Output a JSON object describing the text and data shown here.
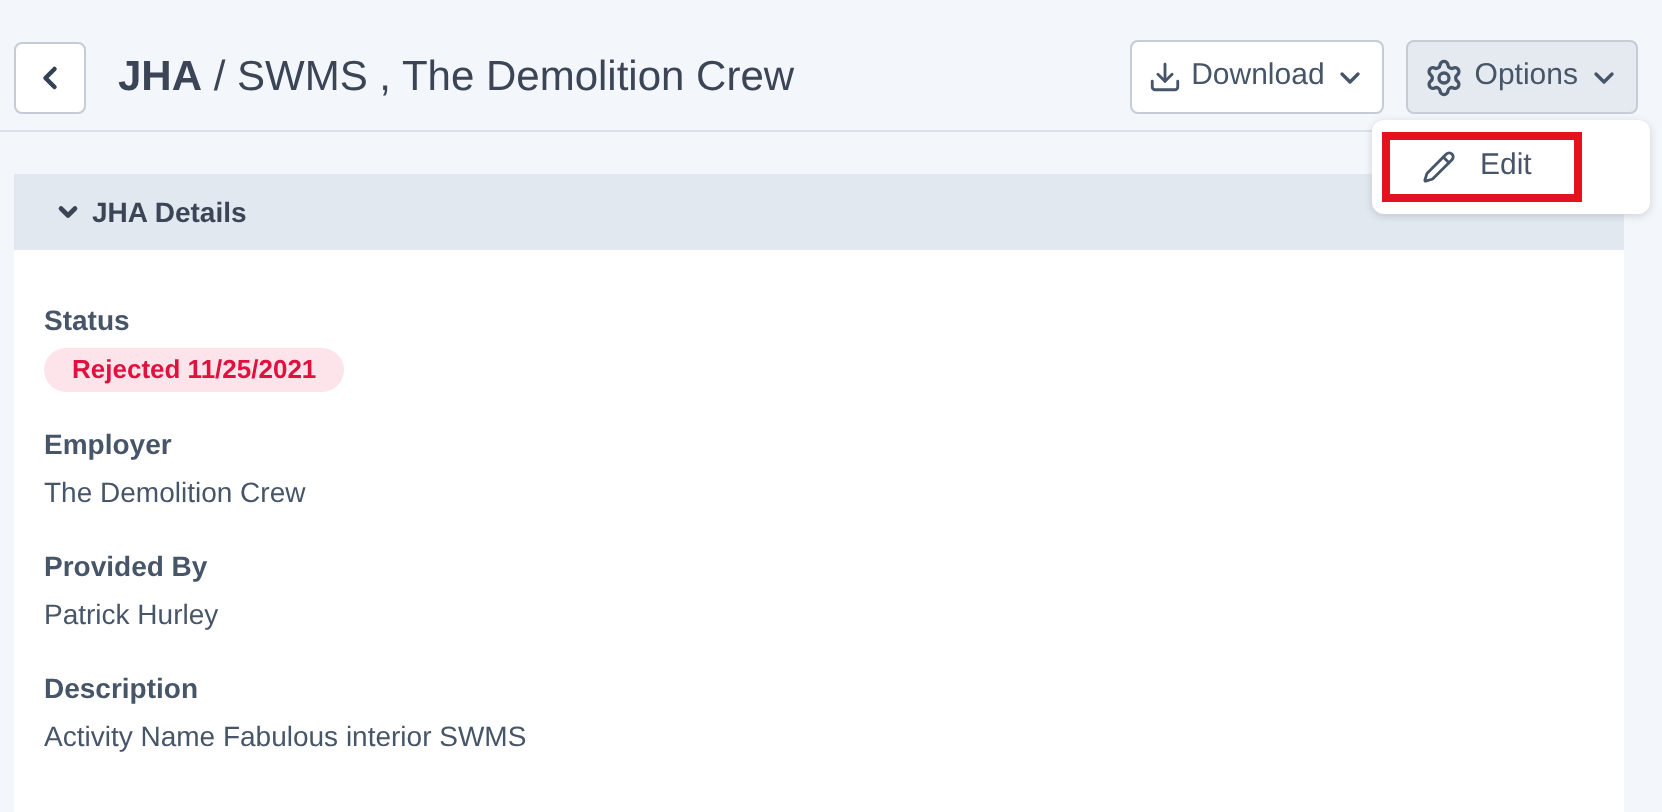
{
  "header": {
    "title": "**JHA** / SWMS , The Demolition Crew",
    "buttons": [
      {
        "label": "Download",
        "kind": "download",
        "active": false
      },
      {
        "label": "Options",
        "kind": "options",
        "active": true
      }
    ]
  },
  "options_menu": {
    "open": true,
    "items": [
      {
        "label": "Edit",
        "highlighted": true
      }
    ]
  },
  "panel": {
    "title": "JHA Details",
    "expanded": true,
    "fields": [
      {
        "label": "Status",
        "kind": "badge",
        "value": "Rejected 11/25/2021"
      },
      {
        "label": "Employer",
        "kind": "text",
        "value": "The Demolition Crew"
      },
      {
        "label": "Provided By",
        "kind": "text",
        "value": "Patrick Hurley"
      },
      {
        "label": "Description",
        "kind": "text",
        "value": "Activity Name Fabulous interior SWMS"
      }
    ]
  }
}
